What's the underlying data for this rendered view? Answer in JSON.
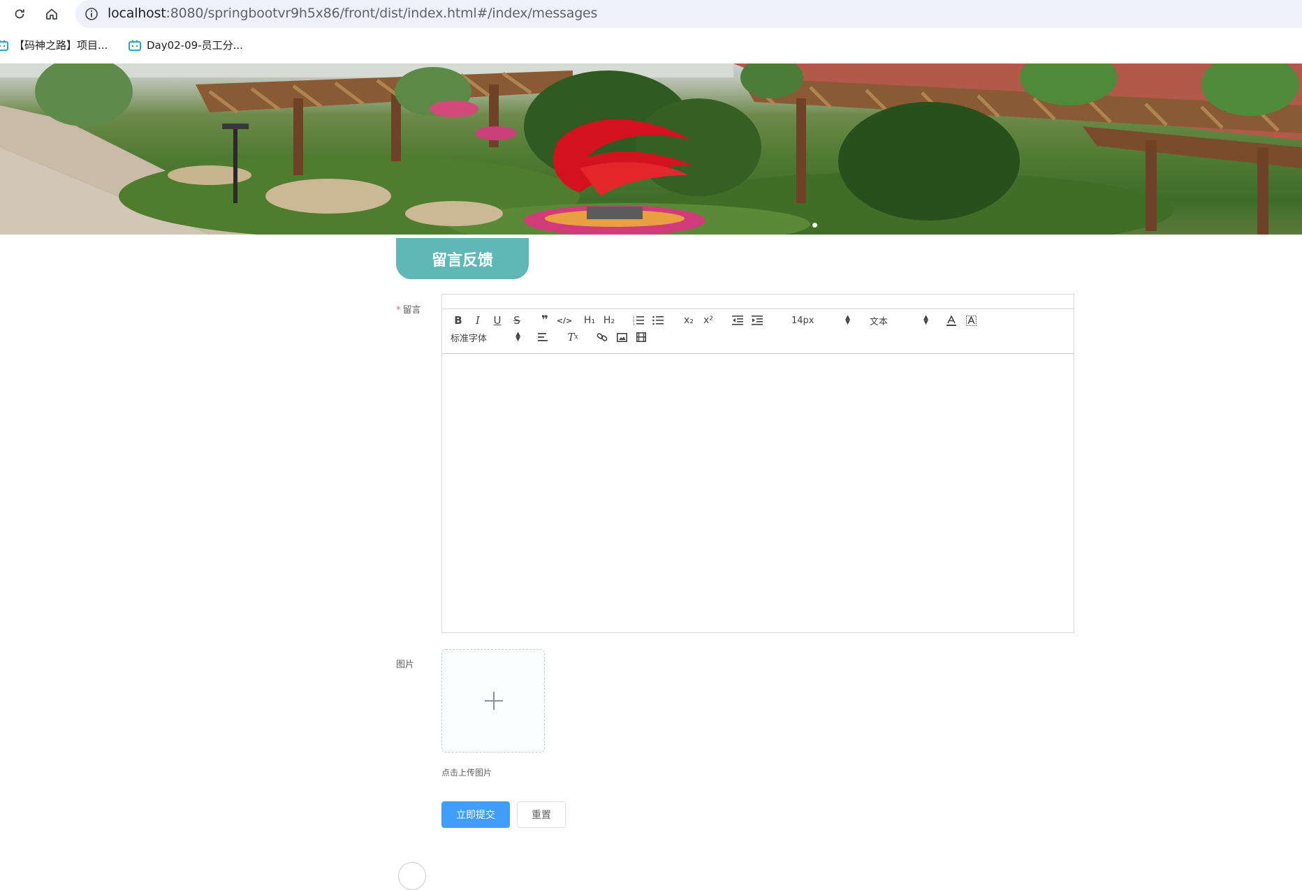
{
  "browser": {
    "url_host": "localhost",
    "url_rest": ":8080/springbootvr9h5x86/front/dist/index.html#/index/messages",
    "bookmarks": [
      {
        "label": "【码神之路】项目...",
        "icon": "tv-icon"
      },
      {
        "label": "Day02-09-员工分...",
        "icon": "tv-icon"
      }
    ]
  },
  "page": {
    "title": "留言反馈"
  },
  "form": {
    "message_label": "留言",
    "required_mark": "*",
    "image_label": "图片",
    "upload_tip": "点击上传图片",
    "submit_label": "立即提交",
    "reset_label": "重置"
  },
  "editor": {
    "size_value": "14px",
    "header_value": "文本",
    "font_value": "标准字体",
    "buttons": [
      "bold",
      "italic",
      "underline",
      "strike",
      "blockquote",
      "code-block",
      "header-1",
      "header-2",
      "ordered-list",
      "bullet-list",
      "subscript",
      "superscript",
      "outdent",
      "indent",
      "color",
      "background",
      "align",
      "clean",
      "link",
      "image",
      "video"
    ]
  },
  "colors": {
    "title_tab": "#60b8b6",
    "primary": "#409eff",
    "required": "#f56c6c"
  }
}
